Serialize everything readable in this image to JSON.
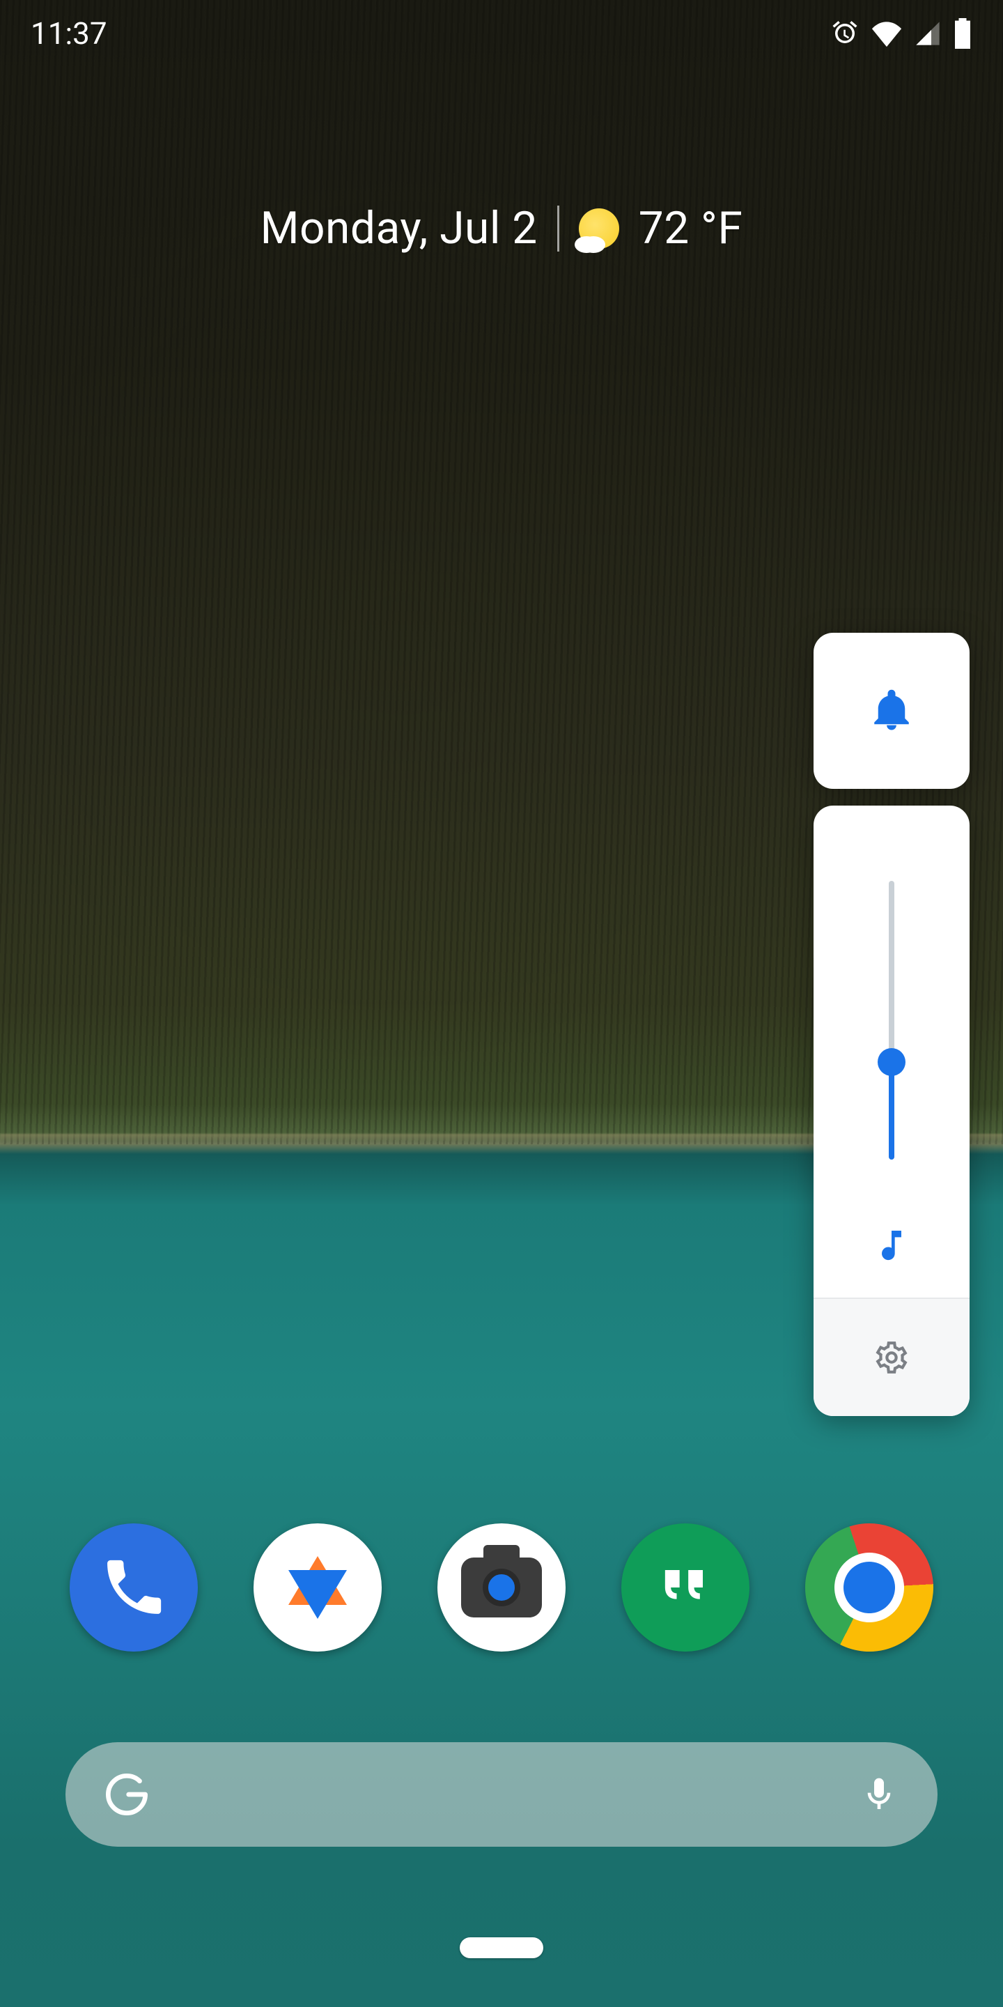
{
  "status": {
    "time": "11:37"
  },
  "glance": {
    "date": "Monday, Jul 2",
    "temperature": "72 °F"
  },
  "volume": {
    "ring_mode": "ring",
    "media_level_percent": 35,
    "output": "media"
  },
  "dock": {
    "apps": [
      {
        "name": "phone"
      },
      {
        "name": "ifttt"
      },
      {
        "name": "camera"
      },
      {
        "name": "hangouts"
      },
      {
        "name": "chrome"
      }
    ]
  },
  "search": {
    "placeholder": ""
  }
}
